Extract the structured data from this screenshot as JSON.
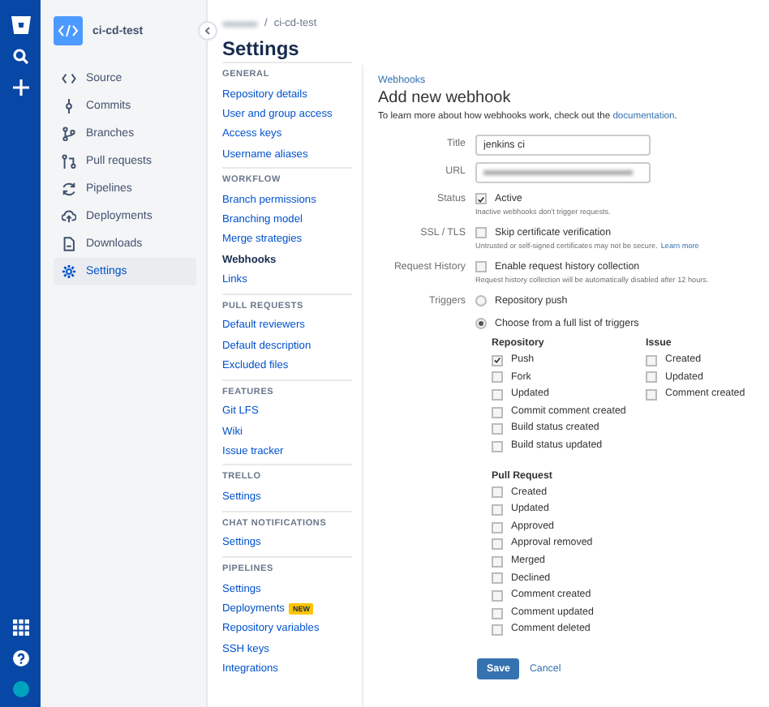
{
  "repo": {
    "name": "ci-cd-test"
  },
  "nav": [
    {
      "label": "Source",
      "selected": false
    },
    {
      "label": "Commits",
      "selected": false
    },
    {
      "label": "Branches",
      "selected": false
    },
    {
      "label": "Pull requests",
      "selected": false
    },
    {
      "label": "Pipelines",
      "selected": false
    },
    {
      "label": "Deployments",
      "selected": false
    },
    {
      "label": "Downloads",
      "selected": false
    },
    {
      "label": "Settings",
      "selected": true
    }
  ],
  "breadcrumb": {
    "separator": "/",
    "current": "ci-cd-test"
  },
  "page_title": "Settings",
  "settings_sections": [
    {
      "heading": "GENERAL",
      "items": [
        {
          "label": "Repository details",
          "selected": false
        },
        {
          "label": "User and group access",
          "selected": false
        },
        {
          "label": "Access keys",
          "selected": false
        },
        {
          "label": "Username aliases",
          "selected": false
        }
      ]
    },
    {
      "heading": "WORKFLOW",
      "items": [
        {
          "label": "Branch permissions",
          "selected": false
        },
        {
          "label": "Branching model",
          "selected": false
        },
        {
          "label": "Merge strategies",
          "selected": false
        },
        {
          "label": "Webhooks",
          "selected": true
        },
        {
          "label": "Links",
          "selected": false
        }
      ]
    },
    {
      "heading": "PULL REQUESTS",
      "items": [
        {
          "label": "Default reviewers",
          "selected": false
        },
        {
          "label": "Default description",
          "selected": false
        },
        {
          "label": "Excluded files",
          "selected": false
        }
      ]
    },
    {
      "heading": "FEATURES",
      "items": [
        {
          "label": "Git LFS",
          "selected": false
        },
        {
          "label": "Wiki",
          "selected": false
        },
        {
          "label": "Issue tracker",
          "selected": false
        }
      ]
    },
    {
      "heading": "TRELLO",
      "items": [
        {
          "label": "Settings",
          "selected": false
        }
      ]
    },
    {
      "heading": "CHAT NOTIFICATIONS",
      "items": [
        {
          "label": "Settings",
          "selected": false
        }
      ]
    },
    {
      "heading": "PIPELINES",
      "items": [
        {
          "label": "Settings",
          "selected": false
        },
        {
          "label": "Deployments",
          "selected": false,
          "badge": "NEW"
        },
        {
          "label": "Repository variables",
          "selected": false
        },
        {
          "label": "SSH keys",
          "selected": false
        },
        {
          "label": "Integrations",
          "selected": false
        }
      ]
    }
  ],
  "form": {
    "back_link": "Webhooks",
    "title": "Add new webhook",
    "intro": {
      "text": "To learn more about how webhooks work, check out the ",
      "link": "documentation",
      "after": "."
    },
    "fields": [
      {
        "kind": "text",
        "label": "Title",
        "value": "jenkins ci"
      },
      {
        "kind": "redacted",
        "label": "URL"
      },
      {
        "kind": "checkbox",
        "label": "Status",
        "option": "Active",
        "checked": true,
        "hint": "Inactive webhooks don't trigger requests."
      },
      {
        "kind": "checkbox",
        "label": "SSL / TLS",
        "option": "Skip certificate verification",
        "checked": false,
        "hint": "Untrusted or self-signed certificates may not be secure.",
        "hint_link": "Learn more"
      },
      {
        "kind": "checkbox",
        "label": "Request History",
        "option": "Enable request history collection",
        "checked": false,
        "hint": "Request history collection will be automatically disabled after 12 hours."
      },
      {
        "kind": "radio",
        "label": "Triggers",
        "options": [
          {
            "label": "Repository push",
            "selected": false
          },
          {
            "label": "Choose from a full list of triggers",
            "selected": true
          }
        ]
      }
    ],
    "trigger_groups": [
      {
        "title": "Repository",
        "items": [
          {
            "label": "Push",
            "checked": true
          },
          {
            "label": "Fork",
            "checked": false
          },
          {
            "label": "Updated",
            "checked": false
          },
          {
            "label": "Commit comment created",
            "checked": false
          },
          {
            "label": "Build status created",
            "checked": false
          },
          {
            "label": "Build status updated",
            "checked": false
          }
        ]
      },
      {
        "title": "Issue",
        "items": [
          {
            "label": "Created",
            "checked": false
          },
          {
            "label": "Updated",
            "checked": false
          },
          {
            "label": "Comment created",
            "checked": false
          }
        ]
      },
      {
        "title": "Pull Request",
        "items": [
          {
            "label": "Created",
            "checked": false
          },
          {
            "label": "Updated",
            "checked": false
          },
          {
            "label": "Approved",
            "checked": false
          },
          {
            "label": "Approval removed",
            "checked": false
          },
          {
            "label": "Merged",
            "checked": false
          },
          {
            "label": "Declined",
            "checked": false
          },
          {
            "label": "Comment created",
            "checked": false
          },
          {
            "label": "Comment updated",
            "checked": false
          },
          {
            "label": "Comment deleted",
            "checked": false
          }
        ]
      }
    ],
    "buttons": [
      {
        "kind": "primary",
        "label": "Save"
      },
      {
        "kind": "link",
        "label": "Cancel"
      }
    ]
  }
}
